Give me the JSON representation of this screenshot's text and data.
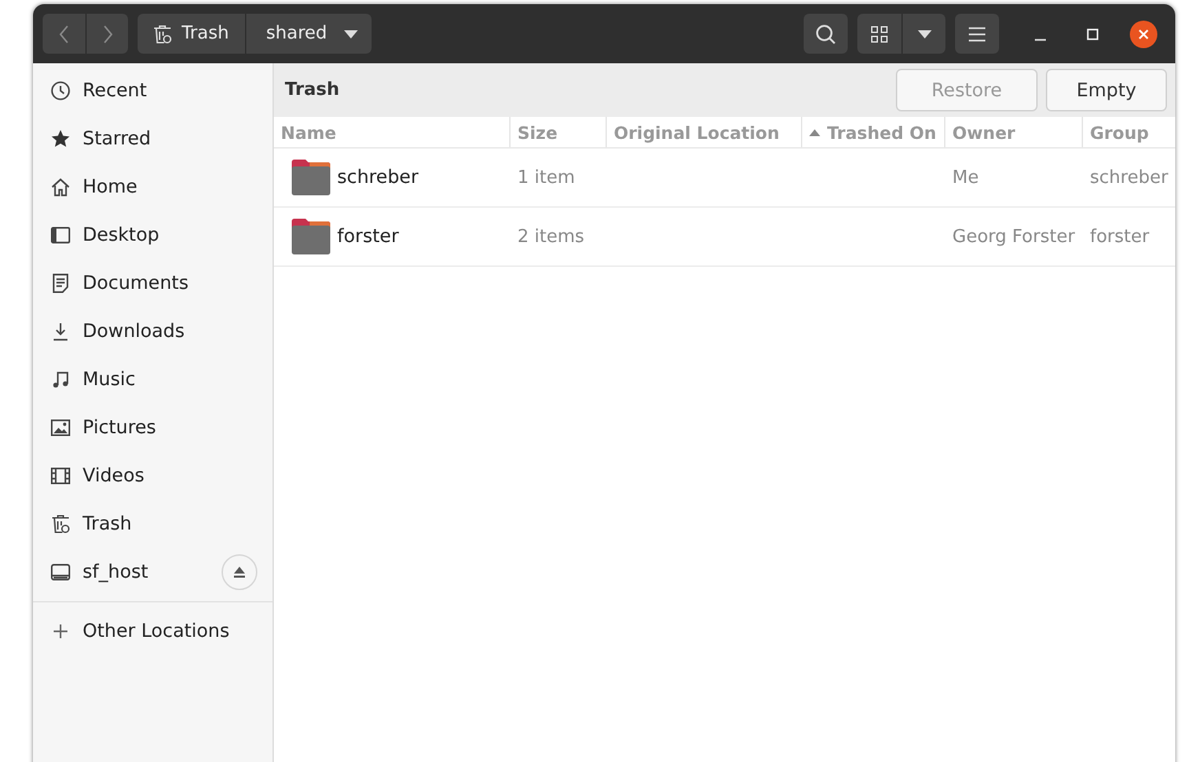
{
  "header": {
    "path": [
      {
        "label": "Trash",
        "selected": false
      },
      {
        "label": "shared",
        "selected": true
      }
    ]
  },
  "sidebar": {
    "items": [
      {
        "label": "Recent",
        "kind": "place",
        "selected": false
      },
      {
        "label": "Starred",
        "kind": "place",
        "selected": false
      },
      {
        "label": "Home",
        "kind": "place",
        "selected": false
      },
      {
        "label": "Desktop",
        "kind": "place",
        "selected": false
      },
      {
        "label": "Documents",
        "kind": "place",
        "selected": false
      },
      {
        "label": "Downloads",
        "kind": "place",
        "selected": false
      },
      {
        "label": "Music",
        "kind": "place",
        "selected": false
      },
      {
        "label": "Pictures",
        "kind": "place",
        "selected": false
      },
      {
        "label": "Videos",
        "kind": "place",
        "selected": false
      },
      {
        "label": "Trash",
        "kind": "place",
        "selected": false
      },
      {
        "label": "sf_host",
        "kind": "device",
        "selected": false
      },
      {
        "label": "Other Locations",
        "kind": "other",
        "selected": false
      }
    ]
  },
  "action_bar": {
    "title": "Trash",
    "buttons": [
      {
        "label": "Restore",
        "disabled": true
      },
      {
        "label": "Empty",
        "disabled": false
      }
    ]
  },
  "table": {
    "columns": [
      {
        "label": "Name",
        "sorted": false
      },
      {
        "label": "Size",
        "sorted": false
      },
      {
        "label": "Original Location",
        "sorted": false
      },
      {
        "label": "Trashed On",
        "sorted": true
      },
      {
        "label": "Owner",
        "sorted": false
      },
      {
        "label": "Group",
        "sorted": false
      }
    ],
    "rows": [
      {
        "name": "schreber",
        "size": "1 item",
        "owner": "Me",
        "group": "schreber"
      },
      {
        "name": "forster",
        "size": "2 items",
        "owner": "Georg Forster",
        "group": "forster"
      }
    ]
  }
}
